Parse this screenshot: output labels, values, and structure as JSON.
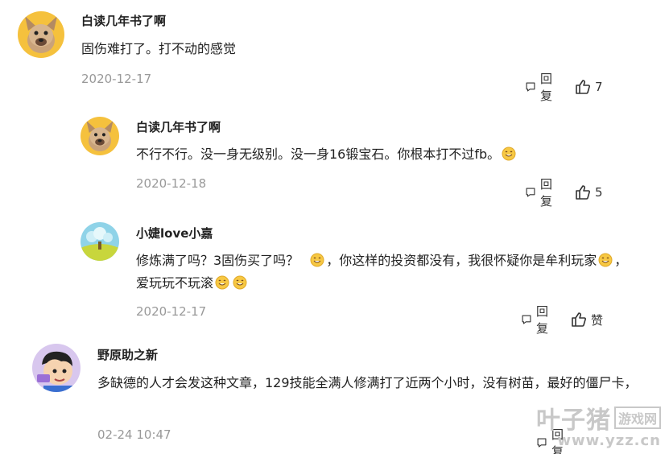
{
  "comments": [
    {
      "username": "白读几年书了啊",
      "text": "固伤难打了。打不动的感觉",
      "date": "2020-12-17",
      "reply_label": "回复",
      "like_count": "7"
    },
    {
      "username": "白读几年书了啊",
      "text": "不行不行。没一身无级别。没一身16锻宝石。你根本打不过fb。",
      "date": "2020-12-18",
      "reply_label": "回复",
      "like_count": "5"
    },
    {
      "username": "小婕love小嘉",
      "text_part1": "修炼满了吗？3固伤买了吗？",
      "text_part2": "，你这样的投资都没有，我很怀疑你是牟利玩家",
      "text_part3": "，爱玩玩不玩滚",
      "date": "2020-12-17",
      "reply_label": "回复",
      "like_label": "赞"
    },
    {
      "username": "野原助之新",
      "text": "多缺德的人才会发这种文章，129技能全满人修满打了近两个小时，没有树苗，最好的僵尸卡，",
      "date": "02-24 10:47",
      "reply_label": "回复"
    }
  ],
  "watermark": {
    "big": "叶子猪",
    "box": "游戏网",
    "url": "www.yzz.cn"
  },
  "icons": [
    "reply-icon",
    "thumbs-up-icon",
    "smile-emoji-icon"
  ]
}
